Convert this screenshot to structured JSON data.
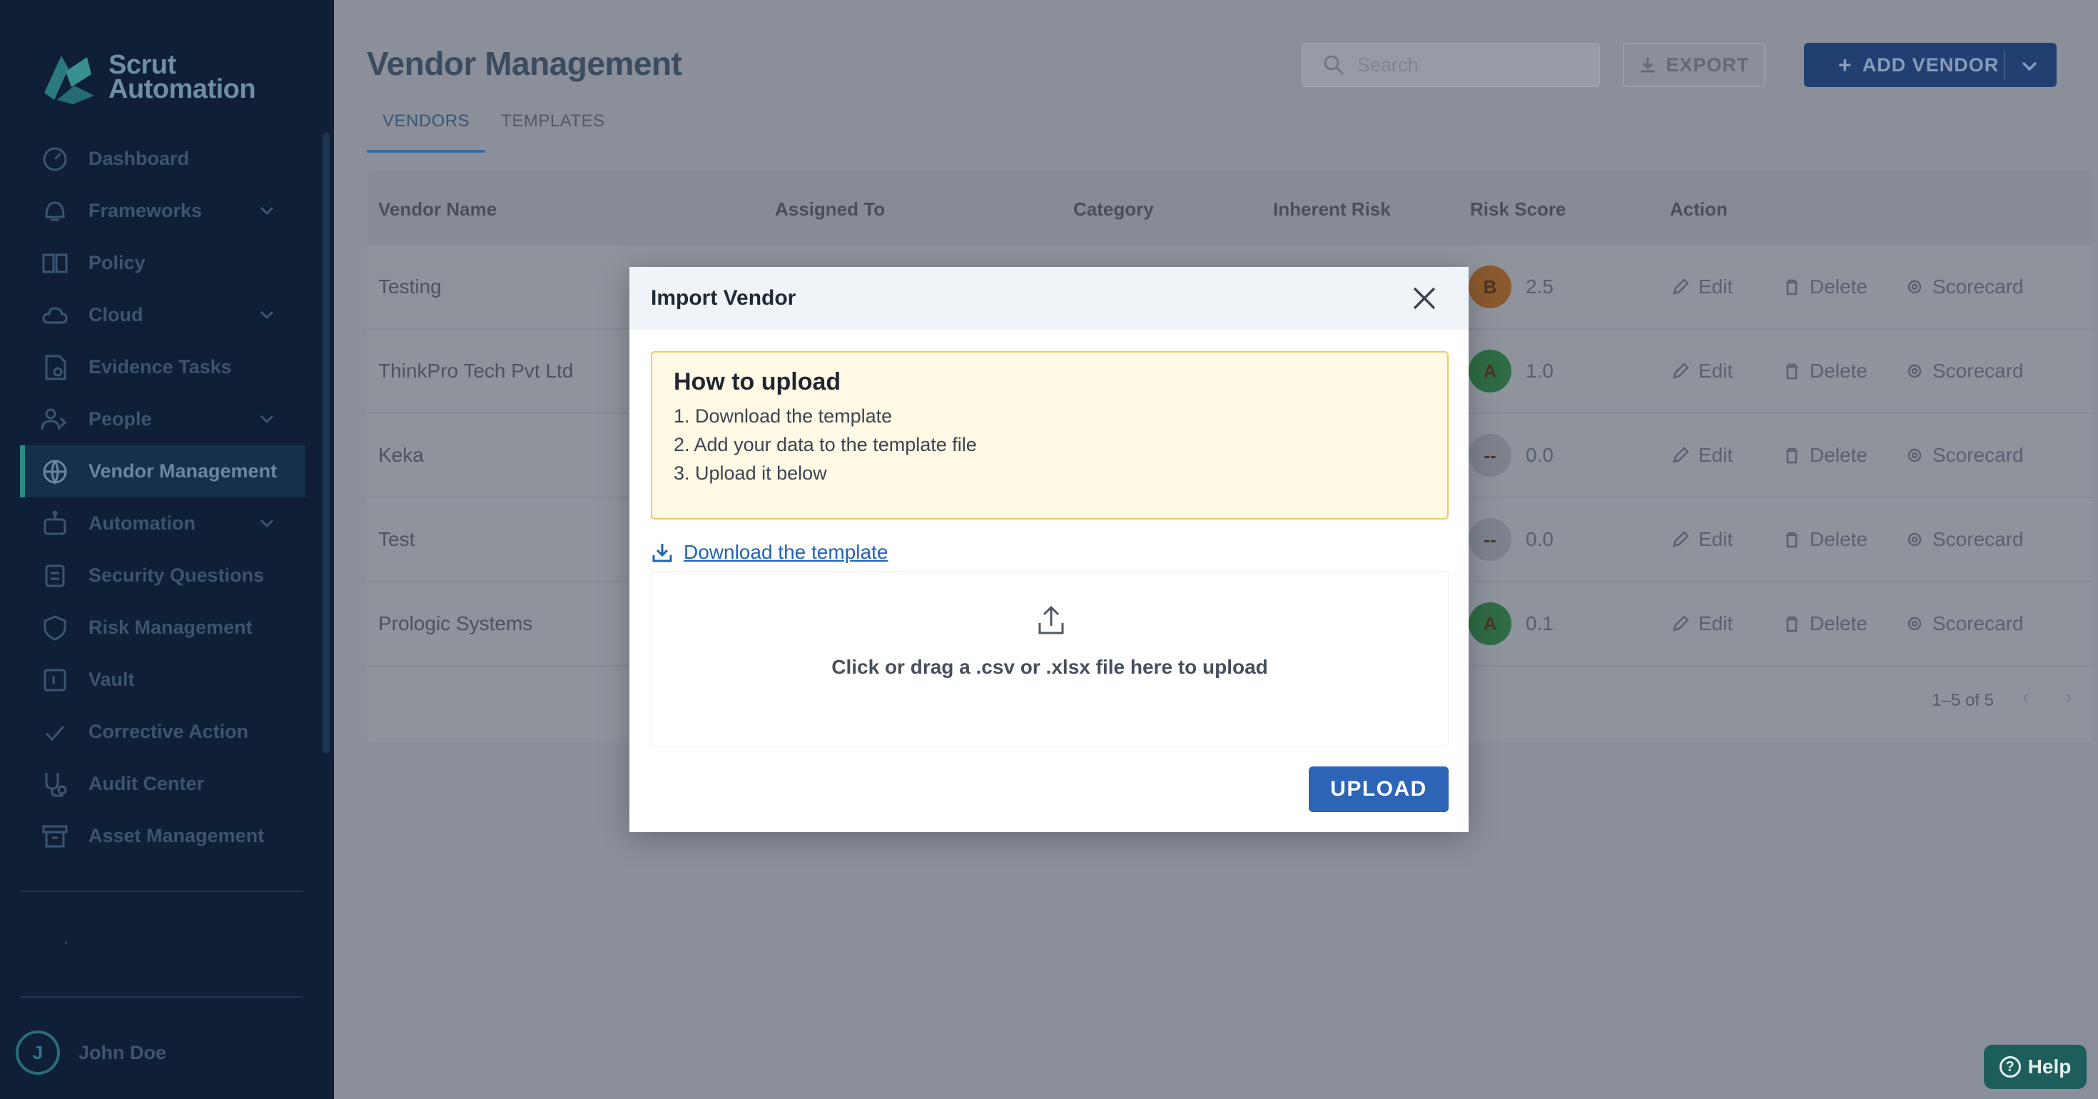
{
  "app": {
    "logo_line1": "Scrut",
    "logo_line2": "Automation"
  },
  "sidebar": {
    "items": [
      {
        "label": "Dashboard",
        "icon": "dashboard-icon",
        "has_chevron": false
      },
      {
        "label": "Frameworks",
        "icon": "frameworks-icon",
        "has_chevron": true
      },
      {
        "label": "Policy",
        "icon": "policy-book-icon",
        "has_chevron": false
      },
      {
        "label": "Cloud",
        "icon": "cloud-icon",
        "has_chevron": true
      },
      {
        "label": "Evidence Tasks",
        "icon": "evidence-icon",
        "has_chevron": false
      },
      {
        "label": "People",
        "icon": "people-icon",
        "has_chevron": true
      },
      {
        "label": "Vendor Management",
        "icon": "vendor-icon",
        "has_chevron": false,
        "active": true
      },
      {
        "label": "Automation",
        "icon": "automation-icon",
        "has_chevron": true
      },
      {
        "label": "Security Questions",
        "icon": "security-questions-icon",
        "has_chevron": false
      },
      {
        "label": "Risk Management",
        "icon": "shield-icon",
        "has_chevron": false
      },
      {
        "label": "Vault",
        "icon": "vault-icon",
        "has_chevron": false
      },
      {
        "label": "Corrective Action",
        "icon": "check-icon",
        "has_chevron": false
      },
      {
        "label": "Audit Center",
        "icon": "audit-icon",
        "has_chevron": false
      },
      {
        "label": "Asset Management",
        "icon": "asset-icon",
        "has_chevron": false
      }
    ],
    "dot": "·",
    "user": {
      "initial": "J",
      "name": "John Doe"
    }
  },
  "header": {
    "title": "Vendor Management",
    "search_placeholder": "Search",
    "export_label": "EXPORT",
    "add_label": "ADD VENDOR",
    "add_plus": "+",
    "tabs": [
      {
        "label": "VENDORS",
        "active": true
      },
      {
        "label": "TEMPLATES",
        "active": false
      }
    ]
  },
  "table": {
    "columns": [
      "Vendor Name",
      "Assigned To",
      "Category",
      "Inherent Risk",
      "Risk Score",
      "Action"
    ],
    "rows": [
      {
        "name": "Testing",
        "grade": "B",
        "grade_color": "#8a5a2e",
        "score": "2.5"
      },
      {
        "name": "ThinkPro Tech Pvt Ltd",
        "grade": "A",
        "grade_color": "#2f6b45",
        "score": "1.0"
      },
      {
        "name": "Keka",
        "grade": "--",
        "grade_color": "#7d838d",
        "score": "0.0"
      },
      {
        "name": "Test",
        "grade": "--",
        "grade_color": "#7d838d",
        "score": "0.0"
      },
      {
        "name": "Prologic Systems",
        "grade": "A",
        "grade_color": "#2f6b45",
        "score": "0.1"
      }
    ],
    "actions": {
      "edit": "Edit",
      "delete": "Delete",
      "scorecard": "Scorecard"
    },
    "pagination": "1–5 of 5",
    "prev": "‹",
    "next": "›"
  },
  "modal": {
    "title": "Import Vendor",
    "howto_title": "How to upload",
    "steps": [
      "1. Download the template",
      "2. Add your data to the template file",
      "3. Upload it below"
    ],
    "download_link": "Download the template",
    "dropzone_text": "Click or drag a .csv or .xlsx file here to upload",
    "upload_label": "UPLOAD"
  },
  "help": {
    "label": "Help",
    "icon_glyph": "?"
  },
  "colors": {
    "sidebar_bg": "#0f1f36",
    "overlay_main": "#8a8f99",
    "accent_blue": "#2d64b5",
    "howto_bg": "#fff9e6",
    "howto_border": "#eec765",
    "help_bg": "#1d5e5c"
  }
}
